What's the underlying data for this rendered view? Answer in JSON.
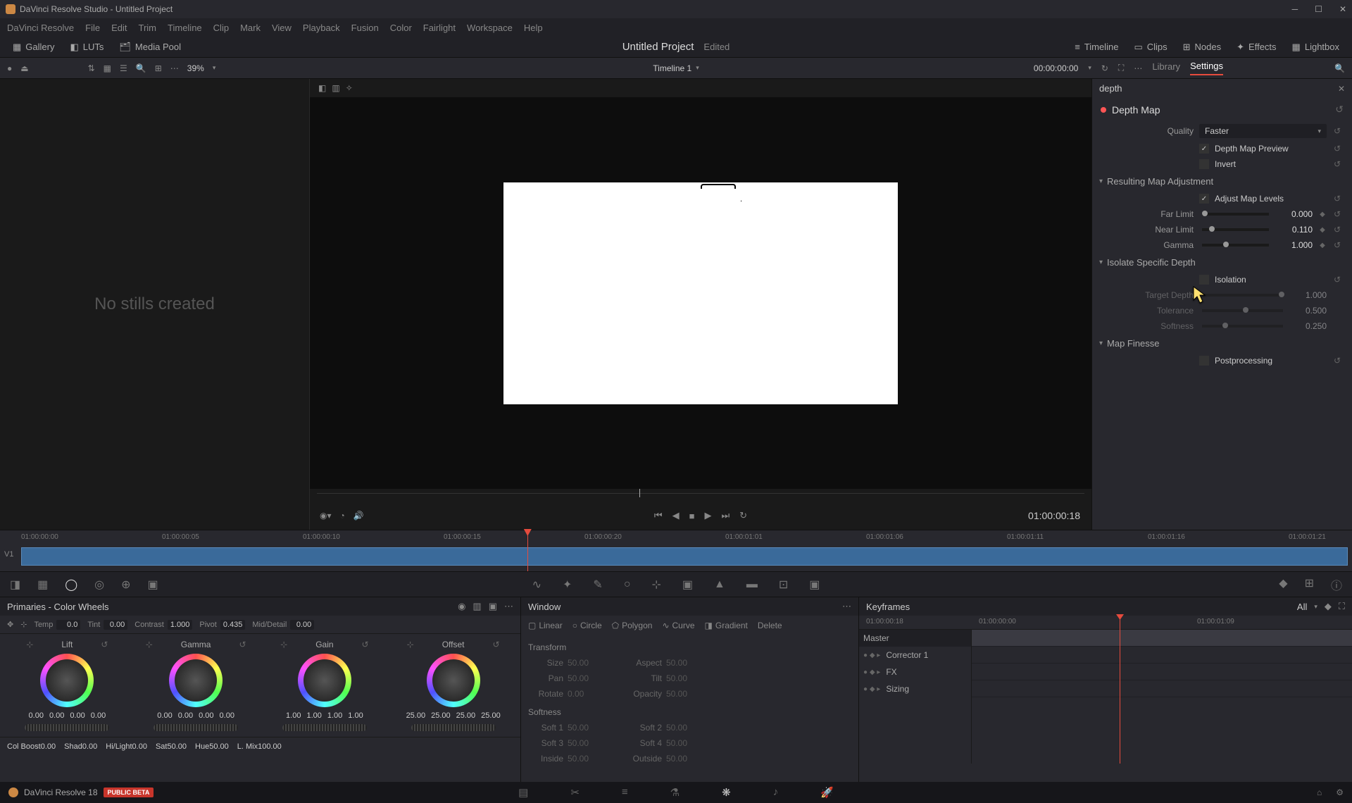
{
  "titlebar": {
    "text": "DaVinci Resolve Studio - Untitled Project"
  },
  "menu": [
    "DaVinci Resolve",
    "File",
    "Edit",
    "Trim",
    "Timeline",
    "Clip",
    "Mark",
    "View",
    "Playback",
    "Fusion",
    "Color",
    "Fairlight",
    "Workspace",
    "Help"
  ],
  "toolbar": {
    "gallery": "Gallery",
    "luts": "LUTs",
    "media_pool": "Media Pool",
    "project_title": "Untitled Project",
    "project_status": "Edited",
    "timeline": "Timeline",
    "clips": "Clips",
    "nodes": "Nodes",
    "effects": "Effects",
    "lightbox": "Lightbox"
  },
  "subtoolbar": {
    "zoom": "39%",
    "timeline_name": "Timeline 1",
    "timecode": "00:00:00:00",
    "library": "Library",
    "settings": "Settings"
  },
  "gallery": {
    "empty": "No stills created"
  },
  "viewer": {
    "timecode": "01:00:00:18"
  },
  "settings": {
    "search": "depth",
    "title": "Depth Map",
    "quality_label": "Quality",
    "quality_value": "Faster",
    "preview": "Depth Map Preview",
    "invert": "Invert",
    "section_adjust": "Resulting Map Adjustment",
    "adjust_levels": "Adjust Map Levels",
    "far_limit_label": "Far Limit",
    "far_limit_value": "0.000",
    "near_limit_label": "Near Limit",
    "near_limit_value": "0.110",
    "gamma_label": "Gamma",
    "gamma_value": "1.000",
    "section_isolate": "Isolate Specific Depth",
    "isolation": "Isolation",
    "target_depth_label": "Target Depth",
    "target_depth_value": "1.000",
    "tolerance_label": "Tolerance",
    "tolerance_value": "0.500",
    "softness_label": "Softness",
    "softness_value": "0.250",
    "section_finesse": "Map Finesse",
    "postprocessing": "Postprocessing"
  },
  "timeline": {
    "track": "V1",
    "tcs": [
      "01:00:00:00",
      "01:00:00:05",
      "01:00:00:10",
      "01:00:00:15",
      "01:00:00:20",
      "01:00:01:01",
      "01:00:01:06",
      "01:00:01:11",
      "01:00:01:16",
      "01:00:01:21"
    ]
  },
  "primaries": {
    "title": "Primaries - Color Wheels",
    "strip": {
      "temp_l": "Temp",
      "temp_v": "0.0",
      "tint_l": "Tint",
      "tint_v": "0.00",
      "contrast_l": "Contrast",
      "contrast_v": "1.000",
      "pivot_l": "Pivot",
      "pivot_v": "0.435",
      "md_l": "Mid/Detail",
      "md_v": "0.00"
    },
    "wheels": [
      {
        "name": "Lift",
        "vals": [
          "0.00",
          "0.00",
          "0.00",
          "0.00"
        ]
      },
      {
        "name": "Gamma",
        "vals": [
          "0.00",
          "0.00",
          "0.00",
          "0.00"
        ]
      },
      {
        "name": "Gain",
        "vals": [
          "1.00",
          "1.00",
          "1.00",
          "1.00"
        ]
      },
      {
        "name": "Offset",
        "vals": [
          "25.00",
          "25.00",
          "25.00",
          "25.00"
        ]
      }
    ],
    "bottom": {
      "colboost_l": "Col Boost",
      "colboost_v": "0.00",
      "shad_l": "Shad",
      "shad_v": "0.00",
      "hilight_l": "Hi/Light",
      "hilight_v": "0.00",
      "sat_l": "Sat",
      "sat_v": "50.00",
      "hue_l": "Hue",
      "hue_v": "50.00",
      "lmix_l": "L. Mix",
      "lmix_v": "100.00"
    }
  },
  "window_panel": {
    "title": "Window",
    "shapes": {
      "linear": "Linear",
      "circle": "Circle",
      "polygon": "Polygon",
      "curve": "Curve",
      "gradient": "Gradient",
      "delete": "Delete"
    },
    "transform": "Transform",
    "size": "Size",
    "size_v": "50.00",
    "aspect": "Aspect",
    "aspect_v": "50.00",
    "pan": "Pan",
    "pan_v": "50.00",
    "tilt": "Tilt",
    "tilt_v": "50.00",
    "rotate": "Rotate",
    "rotate_v": "0.00",
    "opacity": "Opacity",
    "opacity_v": "50.00",
    "softness": "Softness",
    "soft1": "Soft 1",
    "soft1_v": "50.00",
    "soft2": "Soft 2",
    "soft2_v": "50.00",
    "soft3": "Soft 3",
    "soft3_v": "50.00",
    "soft4": "Soft 4",
    "soft4_v": "50.00",
    "inside": "Inside",
    "inside_v": "50.00",
    "outside": "Outside",
    "outside_v": "50.00"
  },
  "keyframes": {
    "title": "Keyframes",
    "all": "All",
    "tc_current": "01:00:00:18",
    "ruler": [
      "01:00:00:00",
      "01:00:01:09"
    ],
    "tree": [
      "Master",
      "Corrector 1",
      "FX",
      "Sizing"
    ]
  },
  "footer": {
    "brand": "DaVinci Resolve 18",
    "beta": "PUBLIC BETA"
  }
}
